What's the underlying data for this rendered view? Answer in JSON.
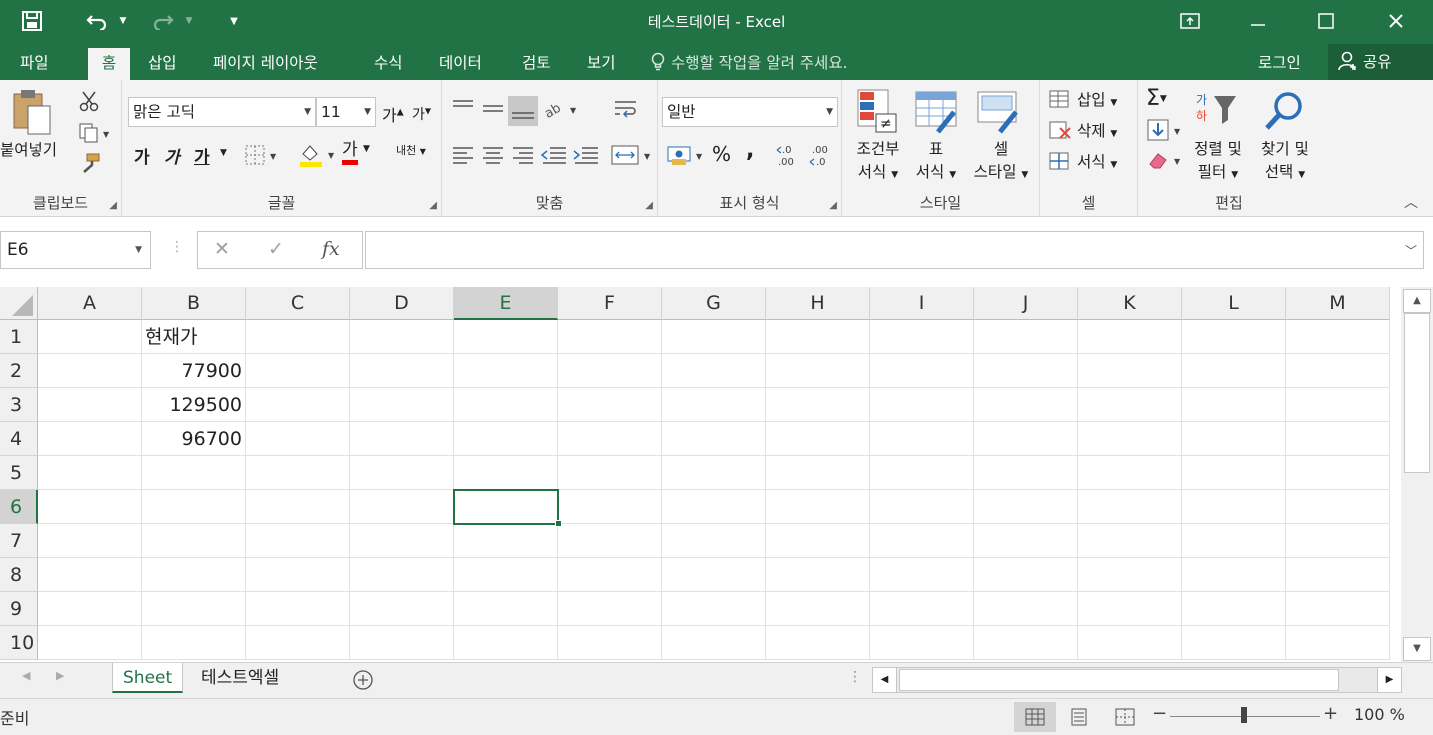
{
  "window": {
    "title": "테스트데이터 - Excel",
    "accent": "#217346"
  },
  "quick_access": [
    {
      "icon": "save-icon"
    },
    {
      "icon": "undo-icon"
    },
    {
      "icon": "redo-icon"
    },
    {
      "icon": "customize-quick-access-icon"
    }
  ],
  "tabs": [
    {
      "label": "파일"
    },
    {
      "label": "홈",
      "active": true
    },
    {
      "label": "삽입"
    },
    {
      "label": "페이지 레이아웃"
    },
    {
      "label": "수식"
    },
    {
      "label": "데이터"
    },
    {
      "label": "검토"
    },
    {
      "label": "보기"
    }
  ],
  "tellme": "수행할 작업을 알려 주세요.",
  "login": "로그인",
  "share": "공유",
  "ribbon": {
    "clipboard": {
      "label": "클립보드",
      "paste": "붙여넣기"
    },
    "font": {
      "label": "글꼴",
      "font_name": "맑은 고딕",
      "font_size": "11",
      "bold": "가",
      "italic": "가",
      "underline": "가",
      "grow": "가",
      "shrink": "가",
      "font_color": "가",
      "phonetic": "내천"
    },
    "alignment": {
      "label": "맞춤"
    },
    "number": {
      "label": "표시 형식",
      "format": "일반",
      "percent": "%",
      "comma": ","
    },
    "styles": {
      "label": "스타일",
      "conditional_1": "조건부",
      "conditional_2": "서식",
      "table_1": "표",
      "table_2": "서식",
      "cell_1": "셀",
      "cell_2": "스타일"
    },
    "cells": {
      "label": "셀",
      "insert": "삽입",
      "delete": "삭제",
      "format": "서식"
    },
    "editing": {
      "label": "편집",
      "sort_1": "정렬 및",
      "sort_2": "필터",
      "find_1": "찾기 및",
      "find_2": "선택"
    }
  },
  "formula_bar": {
    "name_box": "E6",
    "formula": ""
  },
  "columns": [
    "A",
    "B",
    "C",
    "D",
    "E",
    "F",
    "G",
    "H",
    "I",
    "J",
    "K",
    "L",
    "M"
  ],
  "rows": [
    "1",
    "2",
    "3",
    "4",
    "5",
    "6",
    "7",
    "8",
    "9",
    "10"
  ],
  "cells": {
    "B1": "현재가",
    "B2": "77900",
    "B3": "129500",
    "B4": "96700"
  },
  "selected_cell": "E6",
  "sheets": [
    {
      "name": "Sheet",
      "active": true
    },
    {
      "name": "테스트엑셀",
      "active": false
    }
  ],
  "status": "준비",
  "zoom": "100 %"
}
